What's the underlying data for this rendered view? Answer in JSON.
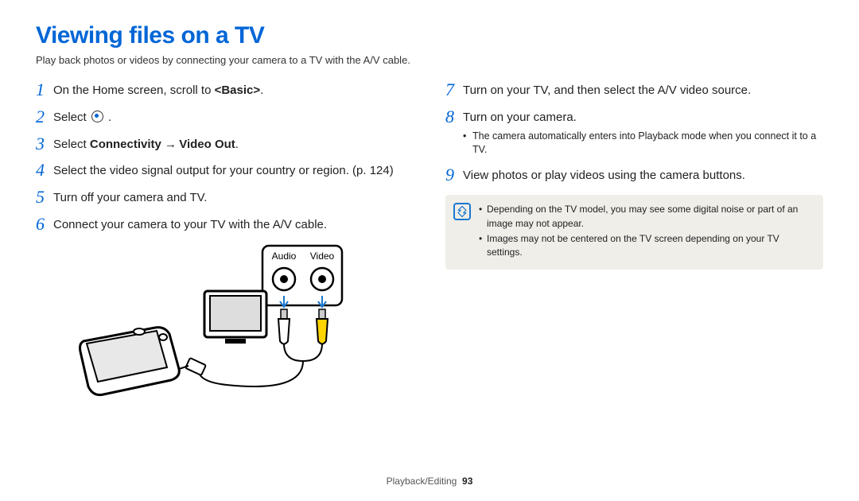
{
  "title": "Viewing files on a TV",
  "intro": "Play back photos or videos by connecting your camera to a TV with the A/V cable.",
  "left_steps": [
    {
      "n": "1",
      "html": "On the Home screen, scroll to <b>&lt;Basic&gt;</b>."
    },
    {
      "n": "2",
      "html": "Select {icon} ."
    },
    {
      "n": "3",
      "html": "Select <b>Connectivity</b> <span class=\"arrow\">→</span> <b>Video Out</b>."
    },
    {
      "n": "4",
      "html": "Select the video signal output for your country or region. (p. 124)"
    },
    {
      "n": "5",
      "html": "Turn off your camera and TV."
    },
    {
      "n": "6",
      "html": "Connect your camera to your TV with the A/V cable."
    }
  ],
  "diagram_labels": {
    "audio": "Audio",
    "video": "Video"
  },
  "right_steps": [
    {
      "n": "7",
      "html": "Turn on your TV, and then select the A/V video source."
    },
    {
      "n": "8",
      "html": "Turn on your camera."
    }
  ],
  "right_sub8": "The camera automatically enters into Playback mode when you connect it to a TV.",
  "right_step9": {
    "n": "9",
    "html": "View photos or play videos using the camera buttons."
  },
  "notes": [
    "Depending on the TV model, you may see some digital noise or part of an image may not appear.",
    "Images may not be centered on the TV screen depending on your TV settings."
  ],
  "footer_section": "Playback/Editing",
  "footer_page": "93"
}
